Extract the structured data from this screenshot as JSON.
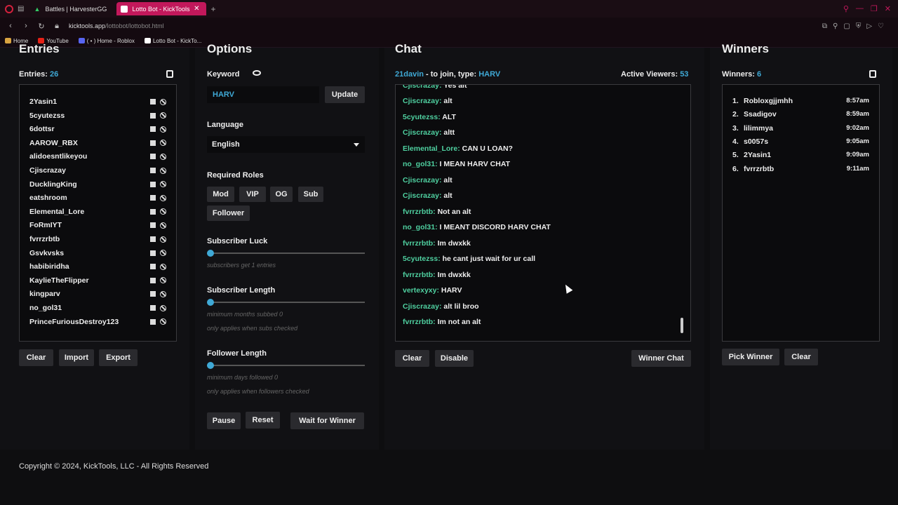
{
  "browser": {
    "tabs": [
      {
        "label": "Battles | HarvesterGG",
        "active": false
      },
      {
        "label": "Lotto Bot - KickTools",
        "active": true
      }
    ],
    "url_host": "kicktools.app",
    "url_path": "/lottobot/lottobot.html",
    "bookmarks": [
      "Home",
      "YouTube",
      "( • ) Home - Roblox",
      "Lotto Bot - KickTo..."
    ]
  },
  "entries": {
    "title": "Entries",
    "label": "Entries:",
    "count": "26",
    "items": [
      "2Yasin1",
      "5cyutezss",
      "6dottsr",
      "AAROW_RBX",
      "alidoesntlikeyou",
      "Cjiscrazay",
      "DucklingKing",
      "eatshroom",
      "Elemental_Lore",
      "FoRmIYT",
      "fvrrzrbtb",
      "Gsvkvsks",
      "habibiridha",
      "KaylieTheFlipper",
      "kingparv",
      "no_gol31",
      "PrinceFuriousDestroy123"
    ],
    "buttons": {
      "clear": "Clear",
      "import": "Import",
      "export": "Export"
    }
  },
  "options": {
    "title": "Options",
    "keyword_label": "Keyword",
    "keyword_value": "HARV",
    "update": "Update",
    "language_label": "Language",
    "language_value": "English",
    "roles_label": "Required Roles",
    "roles": [
      "Mod",
      "VIP",
      "OG",
      "Sub",
      "Follower"
    ],
    "sub_luck_label": "Subscriber Luck",
    "sub_luck_hint": "subscribers get 1 entries",
    "sub_length_label": "Subscriber Length",
    "sub_length_hint1": "minimum months subbed 0",
    "sub_length_hint2": "only applies when subs checked",
    "fol_length_label": "Follower Length",
    "fol_length_hint1": "minimum days followed 0",
    "fol_length_hint2": "only applies when followers checked",
    "buttons": {
      "pause": "Pause",
      "reset": "Reset",
      "wait": "Wait for Winner"
    }
  },
  "chat": {
    "title": "Chat",
    "host": "21davin",
    "join_text": "- to join, type:",
    "keyword": "HARV",
    "viewers_label": "Active Viewers:",
    "viewers": "53",
    "partial_line": {
      "user": "Cjiscrazay:",
      "msg": "Yes alt"
    },
    "messages": [
      {
        "user": "Cjiscrazay:",
        "msg": "alt"
      },
      {
        "user": "5cyutezss:",
        "msg": "ALT"
      },
      {
        "user": "Cjiscrazay:",
        "msg": "altt"
      },
      {
        "user": "Elemental_Lore:",
        "msg": "CAN U LOAN?"
      },
      {
        "user": "no_gol31:",
        "msg": "I MEAN HARV CHAT"
      },
      {
        "user": "Cjiscrazay:",
        "msg": "alt"
      },
      {
        "user": "Cjiscrazay:",
        "msg": "alt"
      },
      {
        "user": "fvrrzrbtb:",
        "msg": "Not an alt"
      },
      {
        "user": "no_gol31:",
        "msg": "I MEANT DISCORD HARV CHAT"
      },
      {
        "user": "fvrrzrbtb:",
        "msg": "Im dwxkk"
      },
      {
        "user": "5cyutezss:",
        "msg": "he cant just wait for ur call"
      },
      {
        "user": "fvrrzrbtb:",
        "msg": "Im dwxkk"
      },
      {
        "user": "vertexyxy:",
        "msg": "HARV"
      },
      {
        "user": "Cjiscrazay:",
        "msg": "alt lil broo"
      },
      {
        "user": "fvrrzrbtb:",
        "msg": "Im not an alt"
      }
    ],
    "buttons": {
      "clear": "Clear",
      "disable": "Disable",
      "winner_chat": "Winner Chat"
    }
  },
  "winners": {
    "title": "Winners",
    "label": "Winners:",
    "count": "6",
    "items": [
      {
        "n": "1.",
        "name": "Robloxgjjmhh",
        "time": "8:57am"
      },
      {
        "n": "2.",
        "name": "Ssadigov",
        "time": "8:59am"
      },
      {
        "n": "3.",
        "name": "lilimmya",
        "time": "9:02am"
      },
      {
        "n": "4.",
        "name": "s0057s",
        "time": "9:05am"
      },
      {
        "n": "5.",
        "name": "2Yasin1",
        "time": "9:09am"
      },
      {
        "n": "6.",
        "name": "fvrrzrbtb",
        "time": "9:11am"
      }
    ],
    "buttons": {
      "pick": "Pick Winner",
      "clear": "Clear"
    }
  },
  "footer": "Copyright © 2024, KickTools, LLC - All Rights Reserved",
  "colors": {
    "accent": "#3fa9d6",
    "username": "#4fd0a0",
    "tab_active": "#c2185b"
  }
}
